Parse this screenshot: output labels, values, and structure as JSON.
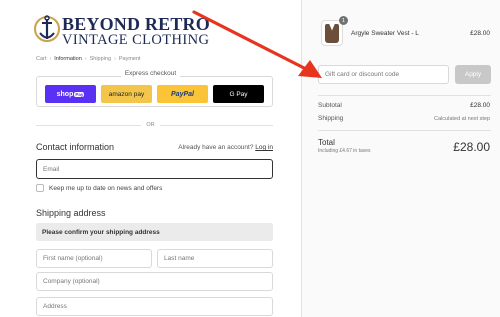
{
  "brand": {
    "line1": "BEYOND RETRO",
    "line2": "VINTAGE CLOTHING",
    "emblem_icon": "anchor-icon"
  },
  "breadcrumb": [
    {
      "label": "Cart"
    },
    {
      "label": "Information",
      "current": true
    },
    {
      "label": "Shipping"
    },
    {
      "label": "Payment"
    }
  ],
  "express_checkout": {
    "title": "Express checkout",
    "buttons": {
      "shop_pay": "shop",
      "shop_pay_tag": "Pay",
      "amazon_pay": "amazon pay",
      "paypal": "PayPal",
      "google_pay": "G Pay"
    },
    "or_label": "OR"
  },
  "contact": {
    "title": "Contact information",
    "account_prompt": "Already have an account?",
    "login_link": "Log in",
    "email_placeholder": "Email",
    "newsletter_label": "Keep me up to date on news and offers"
  },
  "shipping": {
    "title": "Shipping address",
    "notice": "Please confirm your shipping address",
    "first_name_placeholder": "First name (optional)",
    "last_name_placeholder": "Last name",
    "company_placeholder": "Company (optional)",
    "address_placeholder": "Address"
  },
  "order_summary": {
    "product": {
      "name": "Argyle Sweater Vest - L",
      "price": "£28.00",
      "quantity": "1"
    },
    "discount_placeholder": "Gift card or discount code",
    "apply_label": "Apply",
    "subtotal_label": "Subtotal",
    "subtotal_value": "£28.00",
    "shipping_label": "Shipping",
    "shipping_value": "Calculated at next step",
    "total_label": "Total",
    "taxes_note": "Including £4.67 in taxes",
    "total_value": "£28.00"
  },
  "colors": {
    "shop_pay": "#5a31f4",
    "amazon_pay": "#f3c54a",
    "paypal": "#fbc438",
    "google_pay": "#000000",
    "annotation_arrow": "#e8331f",
    "brand_navy": "#1e2a55"
  }
}
